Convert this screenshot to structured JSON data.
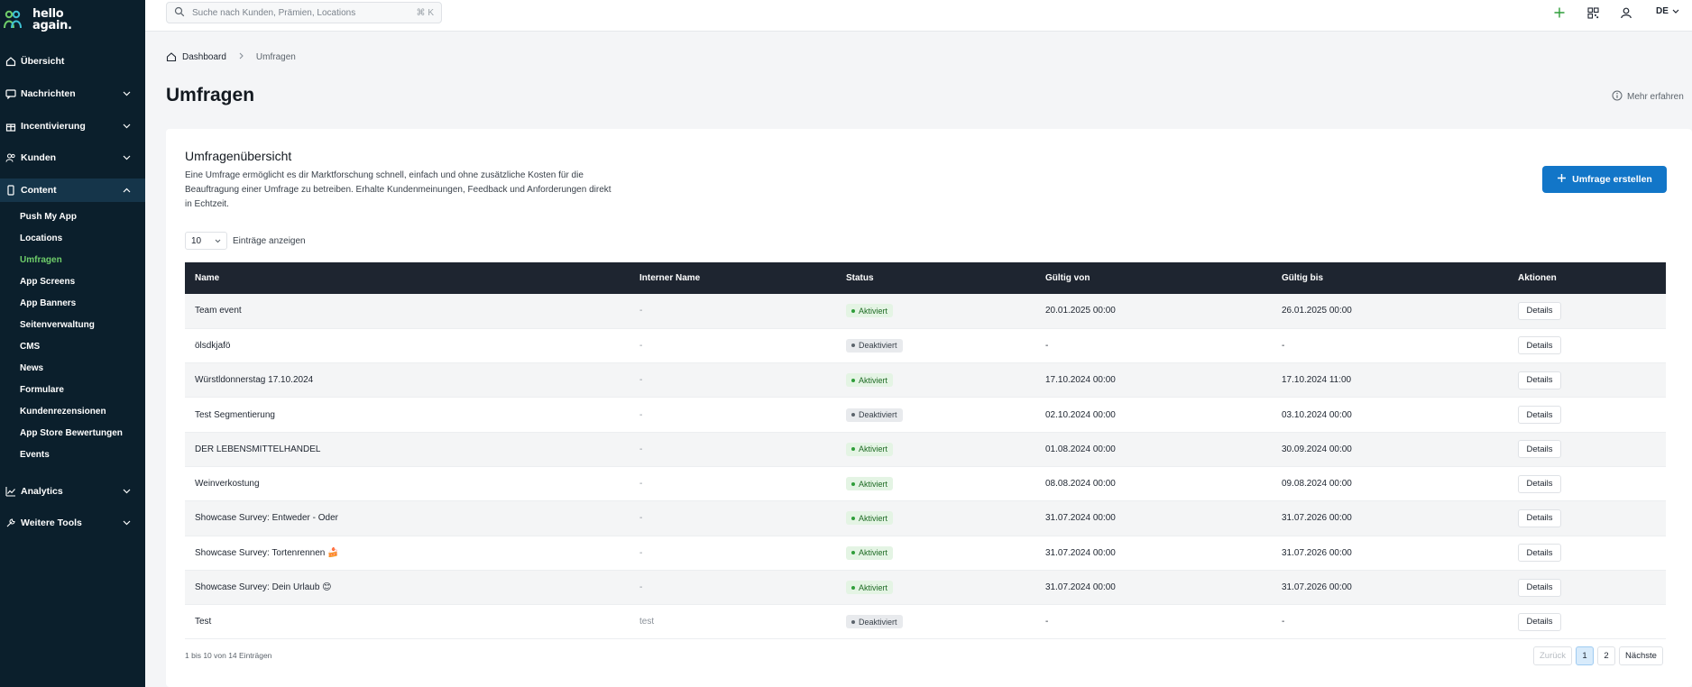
{
  "app": {
    "logo_line1": "hello",
    "logo_line2": "again."
  },
  "sidebar": {
    "items": [
      {
        "label": "Übersicht",
        "icon": "home-icon"
      },
      {
        "label": "Nachrichten",
        "icon": "message-icon"
      },
      {
        "label": "Incentivierung",
        "icon": "gift-icon"
      },
      {
        "label": "Kunden",
        "icon": "users-icon"
      },
      {
        "label": "Content",
        "icon": "phone-icon"
      },
      {
        "label": "Analytics",
        "icon": "chart-icon"
      },
      {
        "label": "Weitere Tools",
        "icon": "tools-icon"
      }
    ],
    "content_sub": [
      "Push My App",
      "Locations",
      "Umfragen",
      "App Screens",
      "App Banners",
      "Seitenverwaltung",
      "CMS",
      "News",
      "Formulare",
      "Kundenrezensionen",
      "App Store Bewertungen",
      "Events"
    ]
  },
  "topbar": {
    "search_placeholder": "Suche nach Kunden, Prämien, Locations",
    "search_shortcut": "⌘ K",
    "lang": "DE"
  },
  "breadcrumb": {
    "home": "Dashboard",
    "current": "Umfragen"
  },
  "page": {
    "title": "Umfragen",
    "learn_more": "Mehr erfahren"
  },
  "card": {
    "title": "Umfragenübersicht",
    "description": "Eine Umfrage ermöglicht es dir Marktforschung schnell, einfach und ohne zusätzliche Kosten für die Beauftragung einer Umfrage zu betreiben. Erhalte Kundenmeinungen, Feedback und Anforderungen direkt in Echtzeit.",
    "create_button": "Umfrage erstellen",
    "page_size": "10",
    "page_size_label": "Einträge anzeigen"
  },
  "table": {
    "headers": [
      "Name",
      "Interner Name",
      "Status",
      "Gültig von",
      "Gültig bis",
      "Aktionen"
    ],
    "rows": [
      {
        "name": "Team event",
        "internal": "-",
        "status": "Aktiviert",
        "from": "20.01.2025 00:00",
        "to": "26.01.2025 00:00",
        "action": "Details"
      },
      {
        "name": "ölsdkjafö",
        "internal": "-",
        "status": "Deaktiviert",
        "from": "-",
        "to": "-",
        "action": "Details"
      },
      {
        "name": "Würstldonnerstag 17.10.2024",
        "internal": "-",
        "status": "Aktiviert",
        "from": "17.10.2024 00:00",
        "to": "17.10.2024 11:00",
        "action": "Details"
      },
      {
        "name": "Test Segmentierung",
        "internal": "-",
        "status": "Deaktiviert",
        "from": "02.10.2024 00:00",
        "to": "03.10.2024 00:00",
        "action": "Details"
      },
      {
        "name": "DER LEBENSMITTELHANDEL",
        "internal": "-",
        "status": "Aktiviert",
        "from": "01.08.2024 00:00",
        "to": "30.09.2024 00:00",
        "action": "Details"
      },
      {
        "name": "Weinverkostung",
        "internal": "-",
        "status": "Aktiviert",
        "from": "08.08.2024 00:00",
        "to": "09.08.2024 00:00",
        "action": "Details"
      },
      {
        "name": "Showcase Survey: Entweder - Oder",
        "internal": "-",
        "status": "Aktiviert",
        "from": "31.07.2024 00:00",
        "to": "31.07.2026 00:00",
        "action": "Details"
      },
      {
        "name": "Showcase Survey: Tortenrennen 🍰",
        "internal": "-",
        "status": "Aktiviert",
        "from": "31.07.2024 00:00",
        "to": "31.07.2026 00:00",
        "action": "Details"
      },
      {
        "name": "Showcase Survey: Dein Urlaub 😊",
        "internal": "-",
        "status": "Aktiviert",
        "from": "31.07.2024 00:00",
        "to": "31.07.2026 00:00",
        "action": "Details"
      },
      {
        "name": "Test",
        "internal": "test",
        "status": "Deaktiviert",
        "from": "-",
        "to": "-",
        "action": "Details"
      }
    ]
  },
  "footer": {
    "info": "1 bis 10 von 14 Einträgen",
    "prev": "Zurück",
    "pages": [
      "1",
      "2"
    ],
    "next": "Nächste"
  },
  "colors": {
    "sidebar_bg": "#0b1f2c",
    "accent": "#1276c8",
    "active_sub": "#6fce6a",
    "table_header": "#1e2530"
  }
}
